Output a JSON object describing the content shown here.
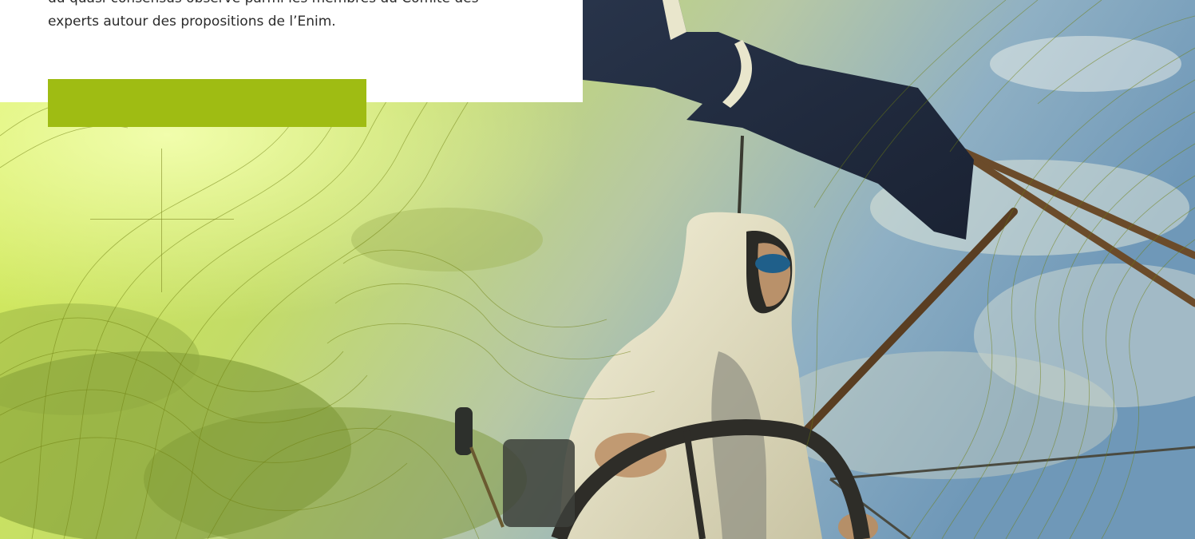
{
  "intro": {
    "lines": [
      "du quasi-consensus observé parmi les membres du Comité des",
      "experts autour des propositions de l’Enim."
    ]
  },
  "cta": {
    "label": "",
    "color": "#9fbc13"
  },
  "hero": {
    "image": "sailor-at-helm-photo",
    "tint": "#c6e04a"
  },
  "decor": {
    "crosshair": "crosshair-icon",
    "contours": "topographic-lines"
  }
}
